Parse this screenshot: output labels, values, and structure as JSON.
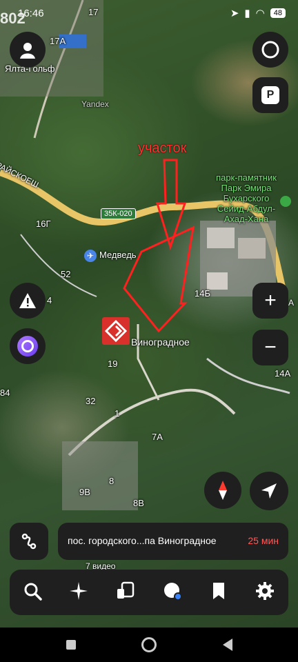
{
  "status": {
    "carrier": "802",
    "time": "16:46",
    "battery": "48"
  },
  "map": {
    "labels": {
      "yalta_golf": "Ялта-Гольф",
      "house_17": "17",
      "house_17a": "17А",
      "yandex": "Yandex",
      "street": "РАЙСКОЕШ.",
      "house_16g": "16Г",
      "road_number": "35К-020",
      "bear": "Медведь",
      "house_52": "52",
      "house_4": "4",
      "house_14b": "14Б",
      "house_19": "19",
      "house_32": "32",
      "house_1": "1",
      "house_7a": "7А",
      "house_9v": "9В",
      "house_8": "8",
      "house_8v": "8В",
      "house_84": "84",
      "house_14a": "14А",
      "video": "7 видео",
      "letters_a": "А",
      "park": "парк-памятник\nПарк Эмира\nБухарского\nСейид-Абдул-\nАхад-Хана",
      "village": "Виноградное",
      "plot": "участок"
    }
  },
  "route": {
    "destination": "пос. городского...па Виноградное",
    "eta": "25 мин"
  },
  "icons": {
    "colors": {
      "accent": "#8a5cf6",
      "warning": "#e53935",
      "annotation": "#ff2020"
    }
  }
}
